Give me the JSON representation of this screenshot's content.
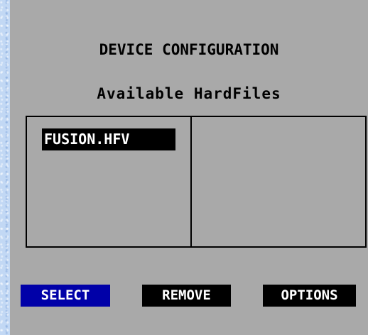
{
  "screen": {
    "title": "DEVICE CONFIGURATION",
    "subtitle": "Available HardFiles"
  },
  "file_list": {
    "items": [
      {
        "label": "FUSION.HFV",
        "selected": true
      }
    ]
  },
  "buttons": {
    "select_label": "SELECT",
    "remove_label": "REMOVE",
    "options_label": "OPTIONS"
  },
  "colors": {
    "panel": "#a9a9a9",
    "background": "#c2d8f4",
    "active_button": "#0000a8",
    "button": "#000000",
    "button_text": "#ffffff"
  }
}
